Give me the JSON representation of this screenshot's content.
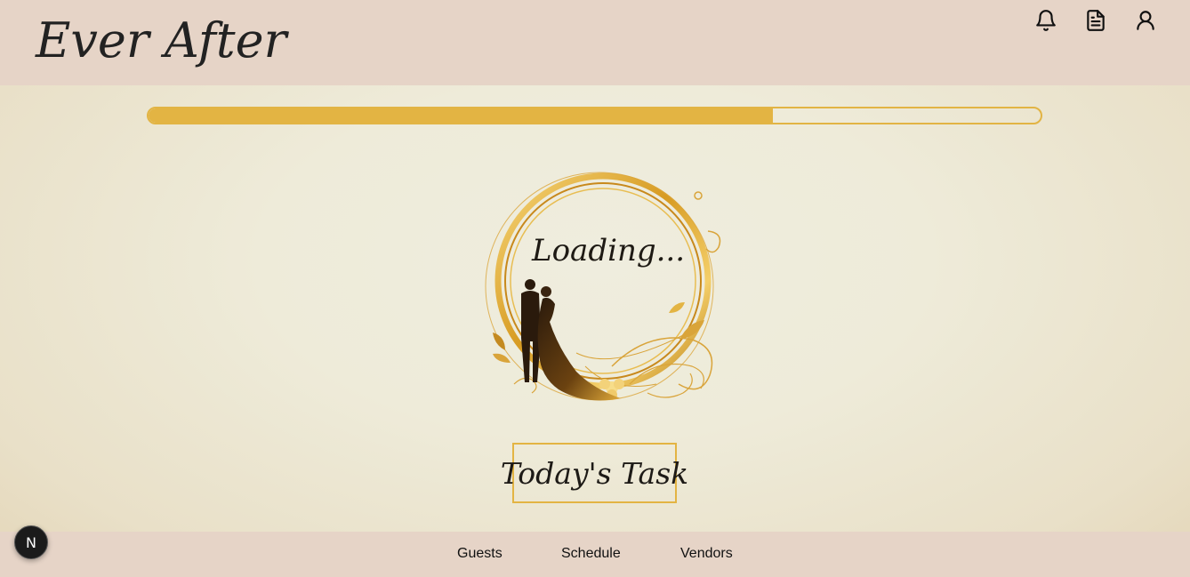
{
  "header": {
    "logo": "Ever After",
    "icons": [
      "bell-icon",
      "document-icon",
      "user-icon"
    ]
  },
  "progress": {
    "value_percent": 70,
    "color": "#e3b443"
  },
  "emblem": {
    "loading_text": "Loading..."
  },
  "task_button": {
    "label": "Today's Task"
  },
  "footer": {
    "links": [
      "Guests",
      "Schedule",
      "Vendors"
    ]
  },
  "dev_badge": {
    "label": "N"
  },
  "colors": {
    "header_bg": "#e6d4c7",
    "accent_gold": "#e3b443",
    "page_bg": "#eeebd9"
  }
}
